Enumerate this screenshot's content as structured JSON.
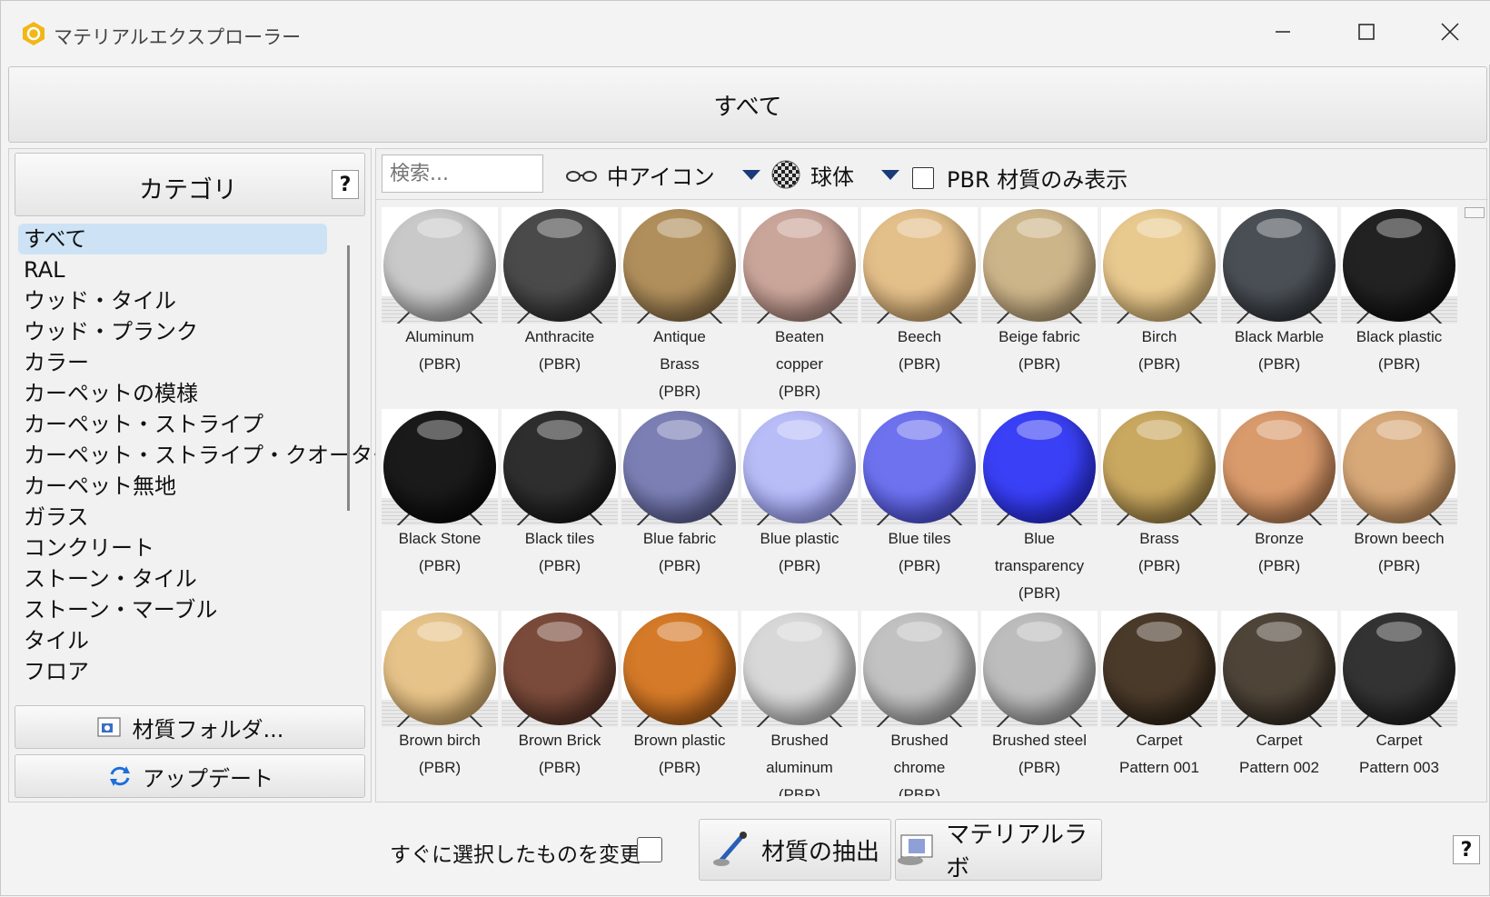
{
  "window": {
    "title": "マテリアルエクスプローラー"
  },
  "top_filter": {
    "label": "すべて"
  },
  "categories": {
    "header": "カテゴリ",
    "help": "?",
    "items": [
      {
        "label": "すべて",
        "selected": true
      },
      {
        "label": "RAL"
      },
      {
        "label": "ウッド・タイル"
      },
      {
        "label": "ウッド・プランク"
      },
      {
        "label": "カラー"
      },
      {
        "label": "カーペットの模様"
      },
      {
        "label": "カーペット・ストライプ"
      },
      {
        "label": "カーペット・ストライプ・クオーター"
      },
      {
        "label": "カーペット無地"
      },
      {
        "label": "ガラス"
      },
      {
        "label": "コンクリート"
      },
      {
        "label": "ストーン・タイル"
      },
      {
        "label": "ストーン・マーブル"
      },
      {
        "label": "タイル"
      },
      {
        "label": "フロア"
      }
    ],
    "folder_button": "材質フォルダ...",
    "update_button": "アップデート"
  },
  "toolbar": {
    "search_placeholder": "検索...",
    "view_mode": "中アイコン",
    "preview_shape": "球体",
    "pbr_only_label": "PBR 材質のみ表示",
    "pbr_only_checked": false
  },
  "materials": [
    {
      "name": "Aluminum\n(PBR)",
      "color": "#c9c9c9",
      "color2": "#8a8a8a"
    },
    {
      "name": "Anthracite\n(PBR)",
      "color": "#4a4a4a",
      "color2": "#1e1e1e"
    },
    {
      "name": "Antique\nBrass\n(PBR)",
      "color": "#b08f5c",
      "color2": "#6b5534"
    },
    {
      "name": "Beaten\ncopper\n(PBR)",
      "color": "#caa59a",
      "color2": "#8a6a62"
    },
    {
      "name": "Beech\n(PBR)",
      "color": "#e3bf8a",
      "color2": "#b08a55"
    },
    {
      "name": "Beige fabric\n(PBR)",
      "color": "#cdb58a",
      "color2": "#9a8460"
    },
    {
      "name": "Birch\n(PBR)",
      "color": "#e8c98e",
      "color2": "#b8975c"
    },
    {
      "name": "Black Marble\n(PBR)",
      "color": "#4a4f55",
      "color2": "#1e2226"
    },
    {
      "name": "Black plastic\n(PBR)",
      "color": "#222222",
      "color2": "#050505"
    },
    {
      "name": "Black Stone\n(PBR)",
      "color": "#1a1a1a",
      "color2": "#000000"
    },
    {
      "name": "Black tiles\n(PBR)",
      "color": "#2e2e2e",
      "color2": "#0a0a0a"
    },
    {
      "name": "Blue fabric\n(PBR)",
      "color": "#7b7fb4",
      "color2": "#45497a"
    },
    {
      "name": "Blue plastic\n(PBR)",
      "color": "#b8bcf7",
      "color2": "#7f84e0"
    },
    {
      "name": "Blue tiles\n(PBR)",
      "color": "#6e72ef",
      "color2": "#3338b8"
    },
    {
      "name": "Blue\ntransparency\n(PBR)",
      "color": "#3a40f5",
      "color2": "#1a1fc0"
    },
    {
      "name": "Brass\n(PBR)",
      "color": "#c9a860",
      "color2": "#7a6130"
    },
    {
      "name": "Bronze\n(PBR)",
      "color": "#d99a6c",
      "color2": "#94603a"
    },
    {
      "name": "Brown beech\n(PBR)",
      "color": "#d7a878",
      "color2": "#a37448"
    },
    {
      "name": "Brown birch\n(PBR)",
      "color": "#e6c389",
      "color2": "#b08a4f"
    },
    {
      "name": "Brown Brick\n(PBR)",
      "color": "#7a4a3a",
      "color2": "#3e241b"
    },
    {
      "name": "Brown plastic\n(PBR)",
      "color": "#d47a28",
      "color2": "#8a4610"
    },
    {
      "name": "Brushed\naluminum\n(PBR)",
      "color": "#d8d8d8",
      "color2": "#9a9a9a"
    },
    {
      "name": "Brushed\nchrome\n(PBR)",
      "color": "#c2c2c2",
      "color2": "#848484"
    },
    {
      "name": "Brushed steel\n(PBR)",
      "color": "#bdbdbd",
      "color2": "#7e7e7e"
    },
    {
      "name": "Carpet\nPattern 001",
      "color": "#4a3a2a",
      "color2": "#1e160e"
    },
    {
      "name": "Carpet\nPattern 002",
      "color": "#4e4438",
      "color2": "#201a14"
    },
    {
      "name": "Carpet\nPattern 003",
      "color": "#333333",
      "color2": "#111111"
    }
  ],
  "bottom": {
    "instant_apply_label": "すぐに選択したものを変更:",
    "instant_apply_checked": false,
    "extract_button": "材質の抽出",
    "lab_button": "マテリアルラボ",
    "help": "?"
  }
}
